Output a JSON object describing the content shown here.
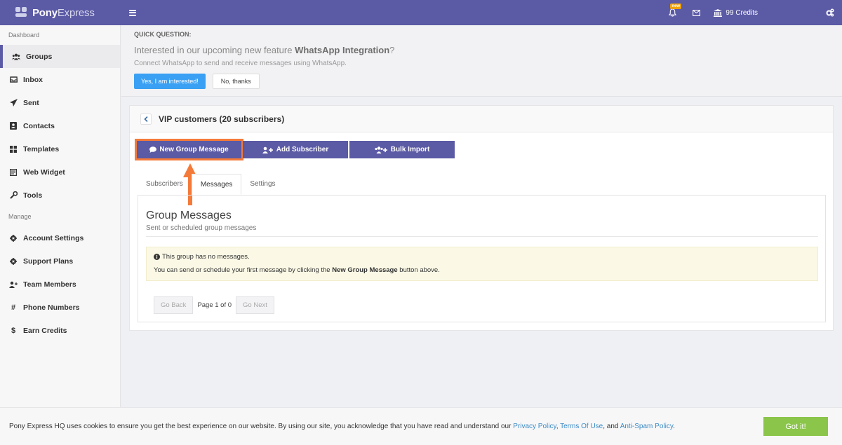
{
  "topbar": {
    "brand_bold": "Pony",
    "brand_light": "Express",
    "notification_badge": "new",
    "credits": "99 Credits"
  },
  "sidebar": {
    "section1": "Dashboard",
    "items": [
      {
        "label": "Groups",
        "icon": "users-icon"
      },
      {
        "label": "Inbox",
        "icon": "inbox-icon"
      },
      {
        "label": "Sent",
        "icon": "paper-plane-icon"
      },
      {
        "label": "Contacts",
        "icon": "contact-book-icon"
      },
      {
        "label": "Templates",
        "icon": "grid-icon"
      },
      {
        "label": "Web Widget",
        "icon": "widget-icon"
      },
      {
        "label": "Tools",
        "icon": "wrench-icon"
      }
    ],
    "section2": "Manage",
    "manage_items": [
      {
        "label": "Account Settings",
        "icon": "gear-icon"
      },
      {
        "label": "Support Plans",
        "icon": "gear-icon"
      },
      {
        "label": "Team Members",
        "icon": "user-plus-icon"
      },
      {
        "label": "Phone Numbers",
        "icon": "hash-icon"
      },
      {
        "label": "Earn Credits",
        "icon": "dollar-icon"
      }
    ]
  },
  "banner": {
    "title": "QUICK QUESTION:",
    "headline_pre": "Interested in our upcoming new feature ",
    "headline_bold": "WhatsApp Integration",
    "headline_post": "?",
    "subtitle": "Connect WhatsApp to send and receive messages using WhatsApp.",
    "yes_label": "Yes, I am interested!",
    "no_label": "No, thanks"
  },
  "group": {
    "title": "VIP customers (20 subscribers)",
    "actions": {
      "new_message": "New Group Message",
      "add_subscriber": "Add Subscriber",
      "bulk_import": "Bulk Import"
    },
    "tabs": [
      "Subscribers",
      "Messages",
      "Settings"
    ],
    "active_tab": "Messages"
  },
  "messages": {
    "title": "Group Messages",
    "subtitle": "Sent or scheduled group messages",
    "alert_line1": "This group has no messages.",
    "alert_line2_pre": "You can send or schedule your first message by clicking the ",
    "alert_line2_bold": "New Group Message",
    "alert_line2_post": " button above.",
    "pager": {
      "back": "Go Back",
      "page_text": "Page 1 of 0",
      "next": "Go Next"
    }
  },
  "cookie": {
    "text_pre": "Pony Express HQ uses cookies to ensure you get the best experience on our website. By using our site, you acknowledge that you have read and understand our ",
    "privacy": "Privacy Policy",
    "sep1": ", ",
    "terms": "Terms Of Use",
    "sep2": ", and ",
    "antispam": "Anti-Spam Policy",
    "end": ".",
    "button": "Got it!"
  },
  "colors": {
    "brand": "#5b5aa5",
    "highlight": "#f47a3a",
    "accept": "#8bc54a",
    "interested": "#3aa0f3"
  }
}
